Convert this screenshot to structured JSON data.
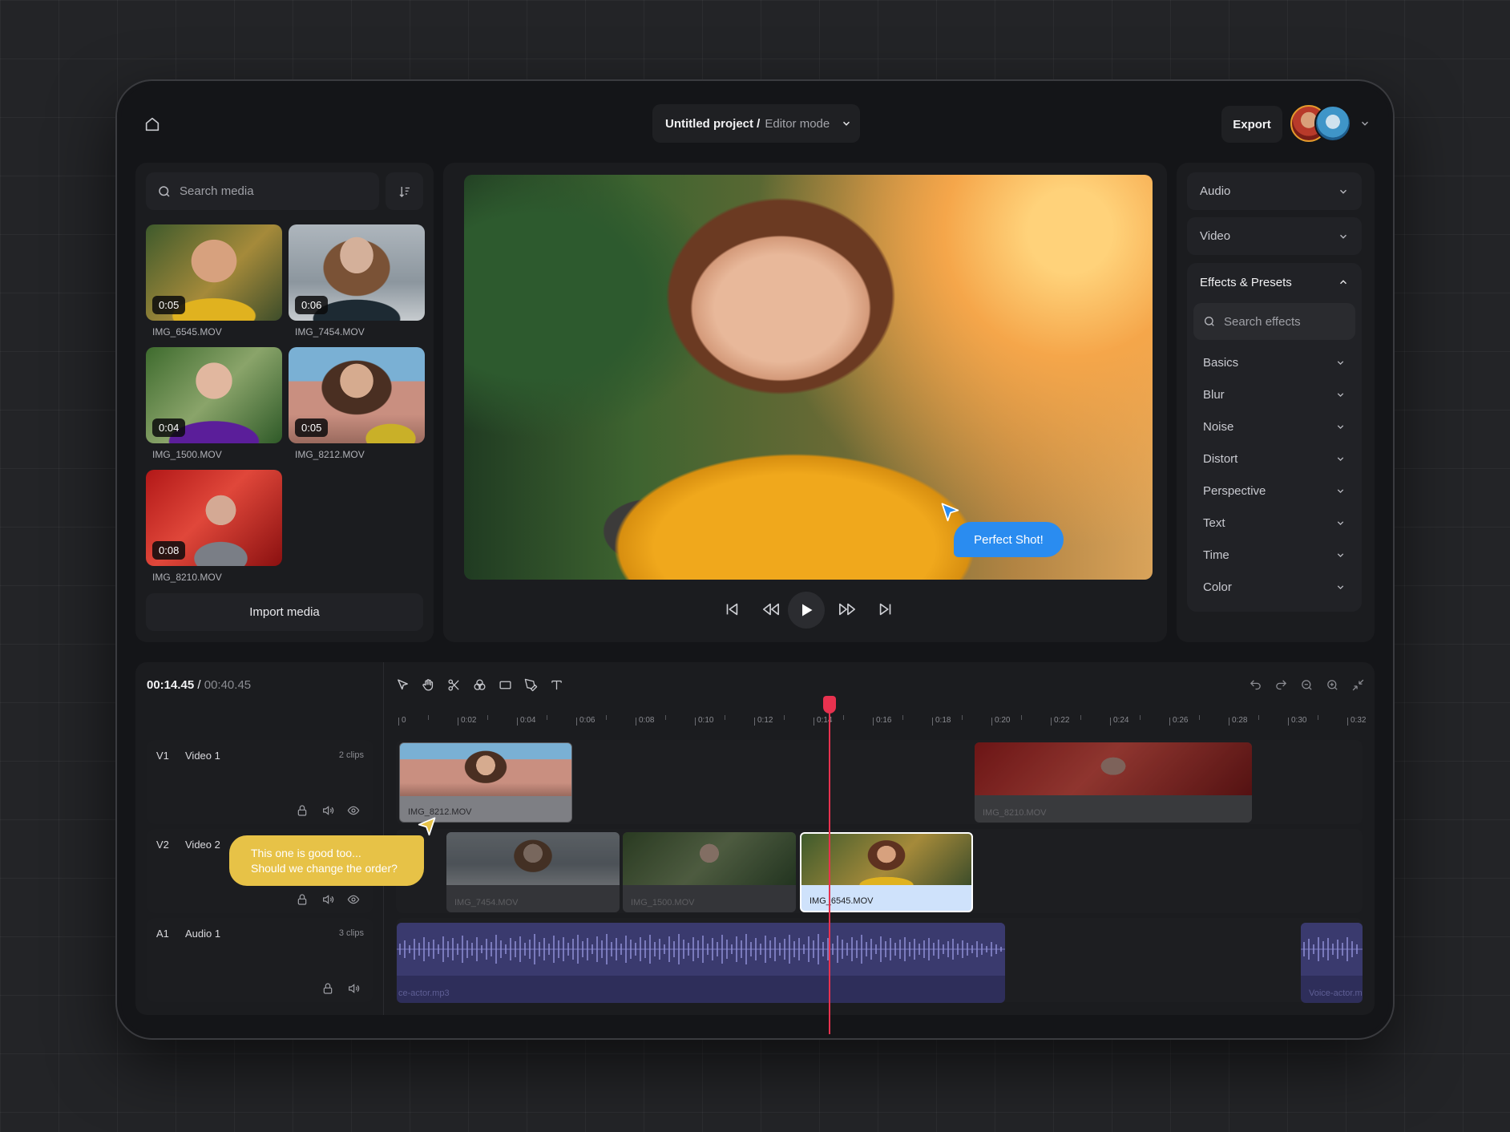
{
  "header": {
    "project_name": "Untitled project /",
    "mode": "Editor mode",
    "export_label": "Export"
  },
  "media": {
    "search_placeholder": "Search media",
    "items": [
      {
        "name": "IMG_6545.MOV",
        "duration": "0:05"
      },
      {
        "name": "IMG_7454.MOV",
        "duration": "0:06"
      },
      {
        "name": "IMG_1500.MOV",
        "duration": "0:04"
      },
      {
        "name": "IMG_8212.MOV",
        "duration": "0:05"
      },
      {
        "name": "IMG_8210.MOV",
        "duration": "0:08"
      }
    ],
    "import_label": "Import media"
  },
  "preview": {
    "bubble": "Perfect Shot!"
  },
  "properties": {
    "audio": "Audio",
    "video": "Video",
    "effects_title": "Effects & Presets",
    "effects_search_placeholder": "Search effects",
    "effects": [
      "Basics",
      "Blur",
      "Noise",
      "Distort",
      "Perspective",
      "Text",
      "Time",
      "Color"
    ]
  },
  "timeline": {
    "current_time": "00:14.45",
    "separator": " / ",
    "total_time": "00:40.45",
    "ruler": [
      "0",
      "0:02",
      "0:04",
      "0:06",
      "0:08",
      "0:10",
      "0:12",
      "0:14",
      "0:16",
      "0:18",
      "0:20",
      "0:22",
      "0:24",
      "0:26",
      "0:28",
      "0:30",
      "0:32"
    ],
    "tracks": [
      {
        "id": "V1",
        "name": "Video 1",
        "count": "2 clips"
      },
      {
        "id": "V2",
        "name": "Video 2",
        "count": ""
      },
      {
        "id": "A1",
        "name": "Audio 1",
        "count": "3 clips"
      }
    ],
    "clips": {
      "v1a": "IMG_8212.MOV",
      "v1b": "IMG_8210.MOV",
      "v2a": "IMG_7454.MOV",
      "v2b": "IMG_1500.MOV",
      "v2c": "IMG_6545.MOV",
      "a1a": "ce-actor.mp3",
      "a1b": "Voice-actor.m"
    },
    "comment": "This one is good too...\nShould we change the order?"
  },
  "colors": {
    "accent_blue": "#2a8cf0",
    "playhead": "#e8324f",
    "comment_yellow": "#e7c247",
    "audio_clip": "#3a3a6e"
  }
}
